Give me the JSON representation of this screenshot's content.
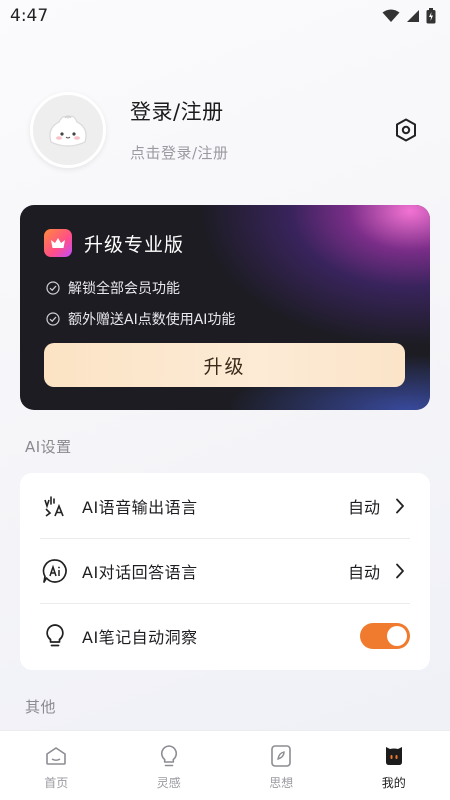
{
  "status_bar": {
    "time": "4:47"
  },
  "profile": {
    "title": "登录/注册",
    "subtitle": "点击登录/注册"
  },
  "upgrade": {
    "title": "升级专业版",
    "features": [
      "解锁全部会员功能",
      "额外赠送AI点数使用AI功能"
    ],
    "button_label": "升级"
  },
  "ai_settings": {
    "section_title": "AI设置",
    "rows": [
      {
        "icon": "voice-language-icon",
        "label": "AI语音输出语言",
        "value": "自动"
      },
      {
        "icon": "ai-chat-icon",
        "label": "AI对话回答语言",
        "value": "自动"
      },
      {
        "icon": "lightbulb-icon",
        "label": "AI笔记自动洞察",
        "toggle_on": true
      }
    ]
  },
  "other": {
    "section_title": "其他"
  },
  "bottom_nav": {
    "items": [
      {
        "label": "首页",
        "icon": "home-icon"
      },
      {
        "label": "灵感",
        "icon": "inspiration-icon"
      },
      {
        "label": "思想",
        "icon": "thoughts-icon"
      },
      {
        "label": "我的",
        "icon": "profile-icon",
        "active": true
      }
    ]
  },
  "colors": {
    "accent": "#f07a2e",
    "card_bg": "#1c1c22",
    "upgrade_button": "#fde7cf"
  }
}
